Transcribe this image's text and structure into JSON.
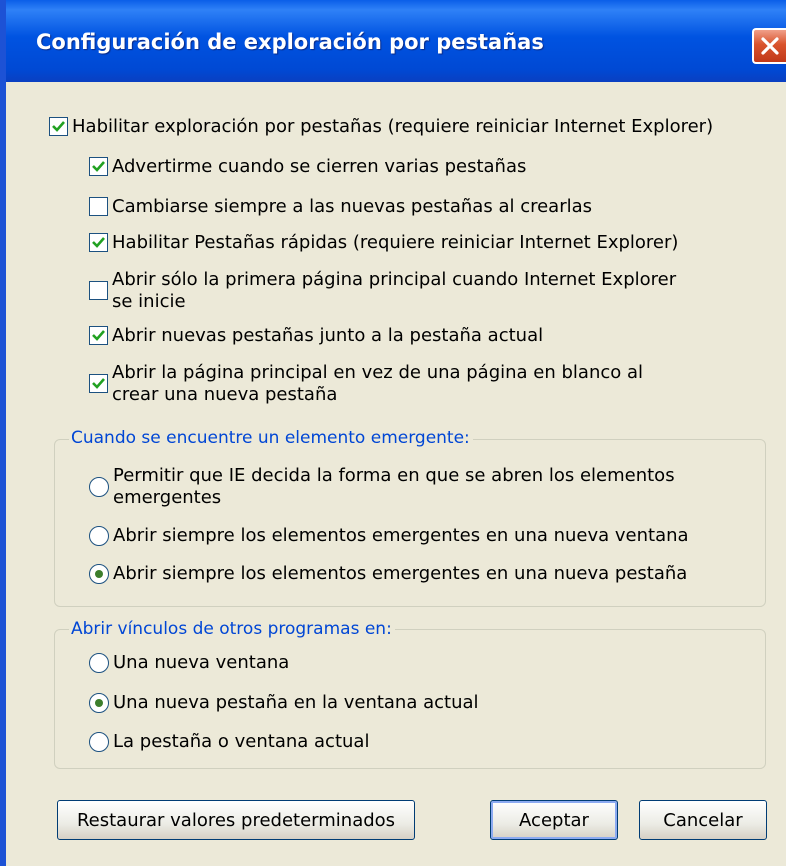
{
  "window": {
    "title": "Configuración de exploración por pestañas"
  },
  "checkboxes": {
    "enable_tabs": {
      "label": "Habilitar exploración por pestañas (requiere reiniciar Internet Explorer)",
      "checked": true
    },
    "warn_close": {
      "label": "Advertirme cuando se cierren varias pestañas",
      "checked": true
    },
    "switch_new": {
      "label": "Cambiarse siempre a las nuevas pestañas al crearlas",
      "checked": false
    },
    "quick_tabs": {
      "label": "Habilitar Pestañas rápidas (requiere reiniciar Internet Explorer)",
      "checked": true
    },
    "first_home_line1": "Abrir sólo la primera página principal cuando Internet Explorer",
    "first_home_line2": "se inicie",
    "open_next": {
      "label": "Abrir nuevas pestañas junto a la pestaña actual",
      "checked": true
    },
    "home_new_line1": "Abrir la página principal en vez de una página en blanco al",
    "home_new_line2": "crear una nueva pestaña"
  },
  "popup_group": {
    "legend": "Cuando se encuentre un elemento emergente:",
    "options": [
      {
        "line1": "Permitir que IE decida la forma en que se abren los elementos",
        "line2": "emergentes",
        "selected": false
      },
      {
        "label": "Abrir siempre los elementos emergentes en una nueva ventana",
        "selected": false
      },
      {
        "label": "Abrir siempre los elementos emergentes en una nueva pestaña",
        "selected": true
      }
    ]
  },
  "links_group": {
    "legend": "Abrir vínculos de otros programas en:",
    "options": [
      {
        "label": "Una nueva ventana",
        "selected": false
      },
      {
        "label": "Una nueva pestaña en la ventana actual",
        "selected": true
      },
      {
        "label": "La pestaña o ventana actual",
        "selected": false
      }
    ]
  },
  "buttons": {
    "restore": "Restaurar valores predeterminados",
    "ok": "Aceptar",
    "cancel": "Cancelar"
  },
  "colors": {
    "titlebar": "#0053e1",
    "dialog_bg": "#ece9d8",
    "legend_text": "#0046d5",
    "check_mark": "#21a121",
    "radio_dot": "#3c7e2c"
  }
}
